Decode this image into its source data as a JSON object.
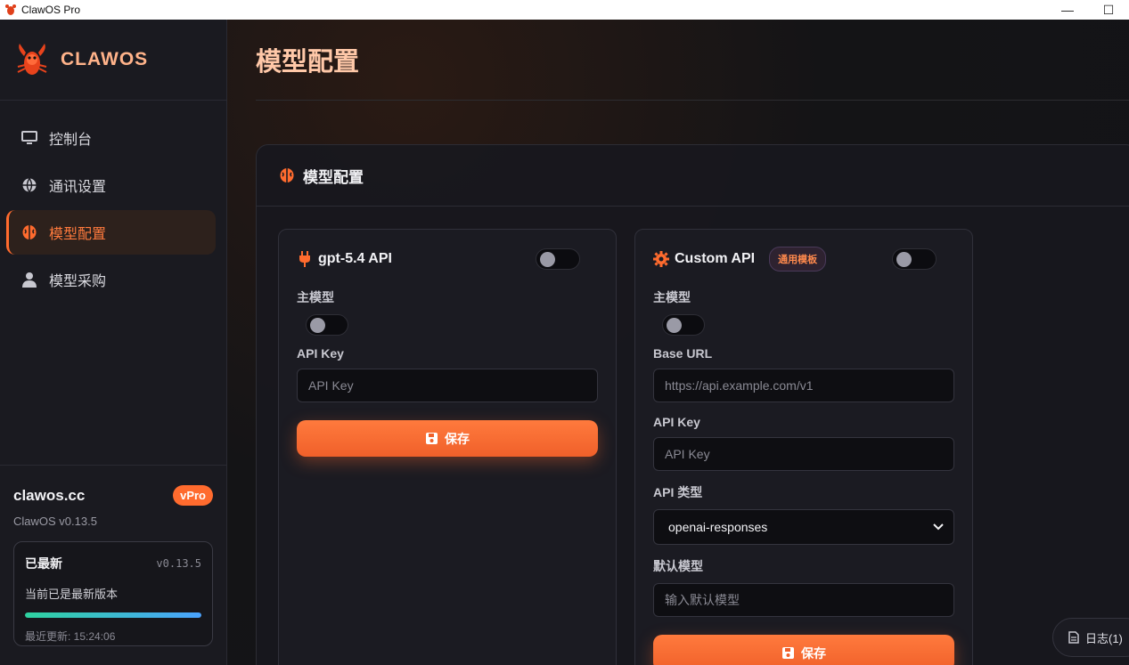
{
  "window": {
    "title": "ClawOS Pro",
    "minimize_glyph": "—",
    "maximize_glyph": "☐"
  },
  "sidebar": {
    "brand": "CLAWOS",
    "items": [
      {
        "label": "控制台",
        "icon": "monitor-icon",
        "active": false
      },
      {
        "label": "通讯设置",
        "icon": "globe-icon",
        "active": false
      },
      {
        "label": "模型配置",
        "icon": "brain-icon",
        "active": true
      },
      {
        "label": "模型采购",
        "icon": "user-icon",
        "active": false
      }
    ],
    "footer": {
      "site": "clawos.cc",
      "badge": "vPro",
      "version": "ClawOS v0.13.5",
      "update": {
        "title": "已最新",
        "version": "v0.13.5",
        "message": "当前已是最新版本",
        "progress": 1.0,
        "last_updated": "最近更新: 15:24:06"
      }
    }
  },
  "main": {
    "page_title": "模型配置",
    "panel_title": "模型配置",
    "cards": [
      {
        "title": "gpt-5.4 API",
        "icon": "plug-icon",
        "enabled": false,
        "primary_label": "主模型",
        "primary_on": false,
        "api_key_label": "API Key",
        "api_key_placeholder": "API Key",
        "save_label": "保存"
      },
      {
        "title": "Custom API",
        "icon": "gear-icon",
        "badge": "通用模板",
        "enabled": false,
        "primary_label": "主模型",
        "primary_on": false,
        "base_url_label": "Base URL",
        "base_url_placeholder": "https://api.example.com/v1",
        "api_key_label": "API Key",
        "api_key_placeholder": "API Key",
        "api_type_label": "API 类型",
        "api_type_value": "openai-responses",
        "default_model_label": "默认模型",
        "default_model_placeholder": "输入默认模型",
        "save_label": "保存"
      }
    ],
    "log_button": "日志(1)"
  },
  "colors": {
    "accent": "#ff6b2e",
    "background": "#141418",
    "sidebar": "#1a1a20",
    "progress_start": "#2ed3a0",
    "progress_end": "#4aa3ff"
  }
}
